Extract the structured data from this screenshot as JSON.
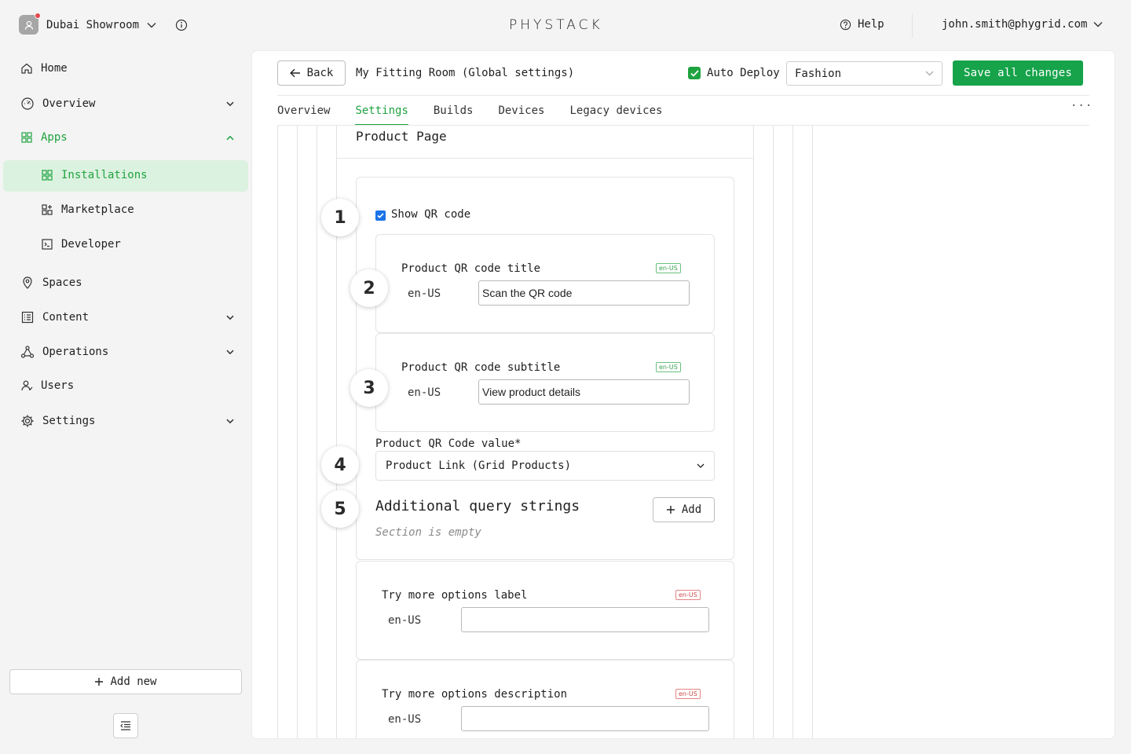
{
  "topbar": {
    "workspace": "Dubai Showroom",
    "logo": "PHYSTACK",
    "help": "Help",
    "user_email": "john.smith@phygrid.com"
  },
  "sidebar": {
    "items": [
      {
        "label": "Home",
        "icon": "home-icon"
      },
      {
        "label": "Overview",
        "icon": "gauge-icon"
      },
      {
        "label": "Apps",
        "icon": "grid-icon"
      },
      {
        "label": "Installations",
        "icon": "grid-icon"
      },
      {
        "label": "Marketplace",
        "icon": "marketplace-icon"
      },
      {
        "label": "Developer",
        "icon": "terminal-icon"
      },
      {
        "label": "Spaces",
        "icon": "location-pin-icon"
      },
      {
        "label": "Content",
        "icon": "list-icon"
      },
      {
        "label": "Operations",
        "icon": "network-icon"
      },
      {
        "label": "Users",
        "icon": "users-icon"
      },
      {
        "label": "Settings",
        "icon": "gear-icon"
      }
    ],
    "add_new": "Add new"
  },
  "header": {
    "back_label": "Back",
    "title": "My Fitting Room (Global settings)",
    "auto_deploy_label": "Auto Deploy",
    "auto_deploy_checked": true,
    "environment": "Fashion",
    "save_label": "Save all changes"
  },
  "tabs": [
    {
      "label": "Overview",
      "active": false
    },
    {
      "label": "Settings",
      "active": true
    },
    {
      "label": "Builds",
      "active": false
    },
    {
      "label": "Devices",
      "active": false
    },
    {
      "label": "Legacy devices",
      "active": false
    }
  ],
  "tabs_more": "···",
  "section": {
    "title": "Product Page",
    "markers": [
      "1",
      "2",
      "3",
      "4",
      "5"
    ],
    "show_qr": {
      "label": "Show QR code",
      "checked": true
    },
    "qr_title": {
      "label": "Product QR code title",
      "locale_tag": "en-US",
      "locale": "en-US",
      "value": "Scan the QR code"
    },
    "qr_subtitle": {
      "label": "Product QR code subtitle",
      "locale_tag": "en-US",
      "locale": "en-US",
      "value": "View product details"
    },
    "qr_value": {
      "label": "Product QR Code value*",
      "selected": "Product Link (Grid Products)"
    },
    "query_strings": {
      "label": "Additional query strings",
      "add_label": "Add",
      "empty_text": "Section is empty"
    },
    "try_more_label": {
      "label": "Try more options label",
      "locale_tag": "en-US",
      "locale": "en-US",
      "value": ""
    },
    "try_more_desc": {
      "label": "Try more options description",
      "locale_tag": "en-US",
      "locale": "en-US",
      "value": ""
    }
  },
  "colors": {
    "accent": "#1fa340",
    "save_button": "#16a34a",
    "active_nav_bg": "#dcf2e0",
    "checkbox_blue": "#1a73e8",
    "error_tag": "#d04a4a"
  }
}
